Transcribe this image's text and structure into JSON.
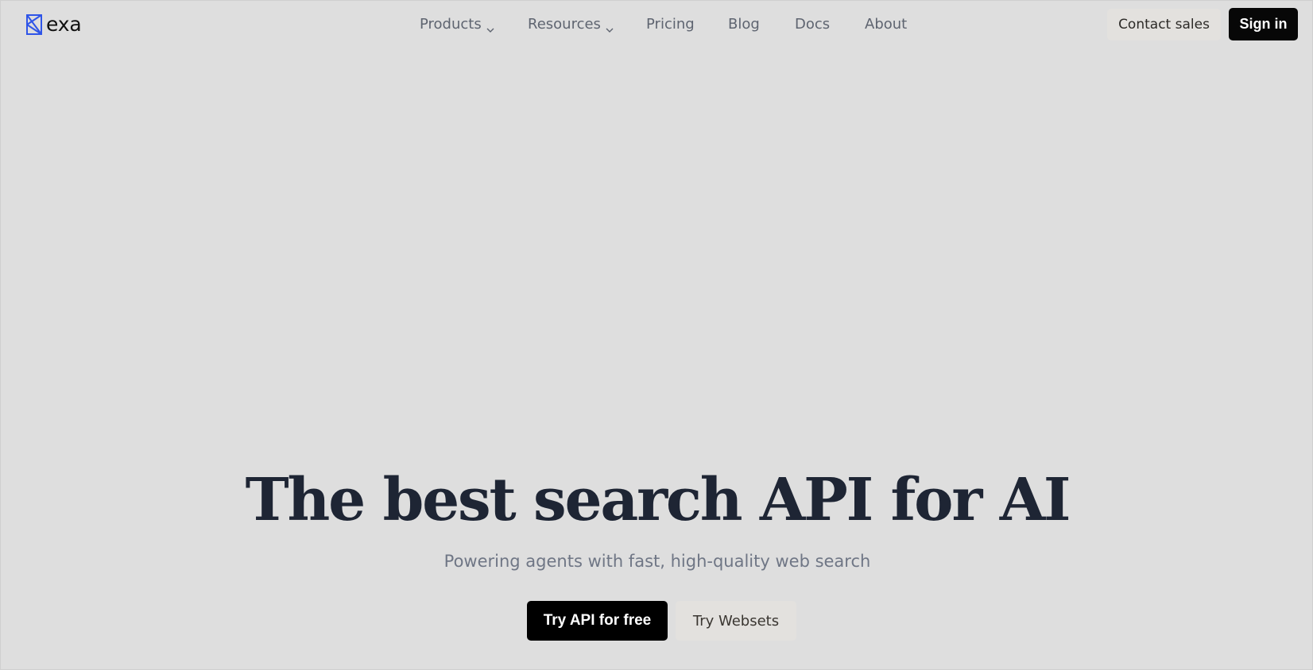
{
  "header": {
    "logo": {
      "text": "exa",
      "icon": "exa-logo-icon"
    },
    "nav": {
      "products": {
        "label": "Products",
        "icon": "chevron-down-icon"
      },
      "resources": {
        "label": "Resources",
        "icon": "chevron-down-icon"
      },
      "pricing": {
        "label": "Pricing"
      },
      "blog": {
        "label": "Blog"
      },
      "docs": {
        "label": "Docs"
      },
      "about": {
        "label": "About"
      }
    },
    "contact_sales": "Contact sales",
    "sign_in": "Sign in"
  },
  "hero": {
    "title": "The best search API for AI",
    "subtitle": "Powering agents with fast, high-quality web search",
    "primary_cta": "Try API for free",
    "secondary_cta": "Try Websets"
  },
  "colors": {
    "background": "#dedede",
    "logo_accent": "#2f55e8",
    "primary_button": "#000000",
    "secondary_button": "#e3e1de",
    "title_text": "#1e2534",
    "subtitle_text": "#6f7685",
    "nav_text": "#5e6470"
  }
}
